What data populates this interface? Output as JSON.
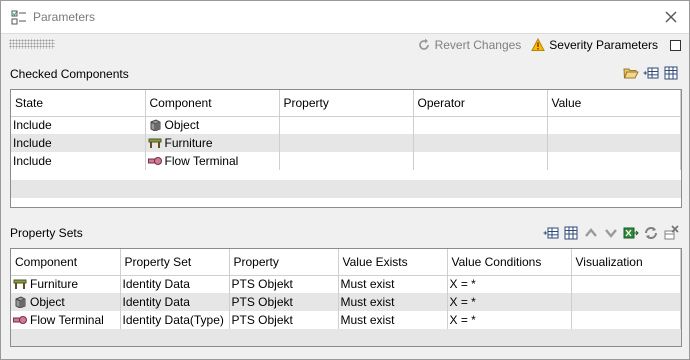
{
  "window": {
    "title": "Parameters"
  },
  "toolbar": {
    "revert_label": "Revert Changes",
    "severity_label": "Severity Parameters"
  },
  "checked_components": {
    "title": "Checked Components",
    "columns": [
      "State",
      "Component",
      "Property",
      "Operator",
      "Value"
    ],
    "rows": [
      {
        "state": "Include",
        "component": "Object",
        "icon": "cube-icon",
        "property": "",
        "operator": "",
        "value": ""
      },
      {
        "state": "Include",
        "component": "Furniture",
        "icon": "table-furniture-icon",
        "property": "",
        "operator": "",
        "value": ""
      },
      {
        "state": "Include",
        "component": "Flow Terminal",
        "icon": "flow-terminal-icon",
        "property": "",
        "operator": "",
        "value": ""
      }
    ]
  },
  "property_sets": {
    "title": "Property Sets",
    "columns": [
      "Component",
      "Property Set",
      "Property",
      "Value Exists",
      "Value Conditions",
      "Visualization"
    ],
    "rows": [
      {
        "component": "Furniture",
        "icon": "table-furniture-icon",
        "property_set": "Identity Data",
        "property": "PTS Objekt",
        "value_exists": "Must exist",
        "value_conditions": "X = *",
        "visualization": ""
      },
      {
        "component": "Object",
        "icon": "cube-icon",
        "property_set": "Identity Data",
        "property": "PTS Objekt",
        "value_exists": "Must exist",
        "value_conditions": "X = *",
        "visualization": ""
      },
      {
        "component": "Flow Terminal",
        "icon": "flow-terminal-icon",
        "property_set": "Identity Data(Type)",
        "property": "PTS Objekt",
        "value_exists": "Must exist",
        "value_conditions": "X = *",
        "visualization": ""
      }
    ]
  },
  "colors": {
    "alt_row": "#e6e6e6",
    "border": "#8c8c8c",
    "warning": "#f2c200"
  }
}
